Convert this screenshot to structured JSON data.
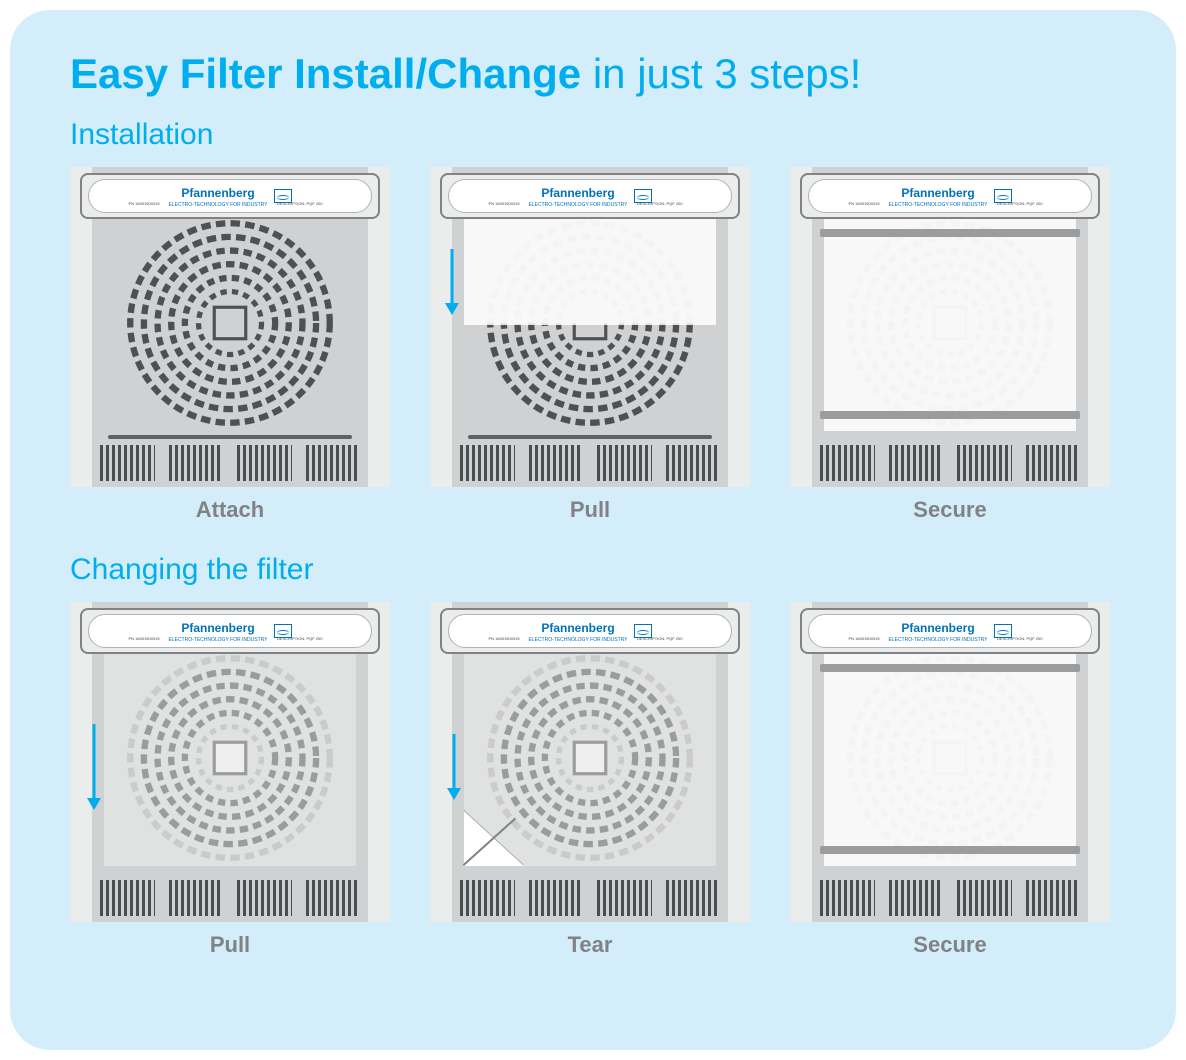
{
  "title_bold": "Easy Filter Install/Change",
  "title_light": " in just 3 steps!",
  "sections": {
    "installation": {
      "label": "Installation",
      "steps": [
        "Attach",
        "Pull",
        "Secure"
      ]
    },
    "changing": {
      "label": "Changing the filter",
      "steps": [
        "Pull",
        "Tear",
        "Secure"
      ]
    }
  },
  "brand": {
    "name": "Pfannenberg",
    "tagline": "ELECTRO-TECHNOLOGY FOR INDUSTRY",
    "meta_left": "PN 18001500015",
    "meta_right": "DESCRIPTION: PQF 200"
  }
}
